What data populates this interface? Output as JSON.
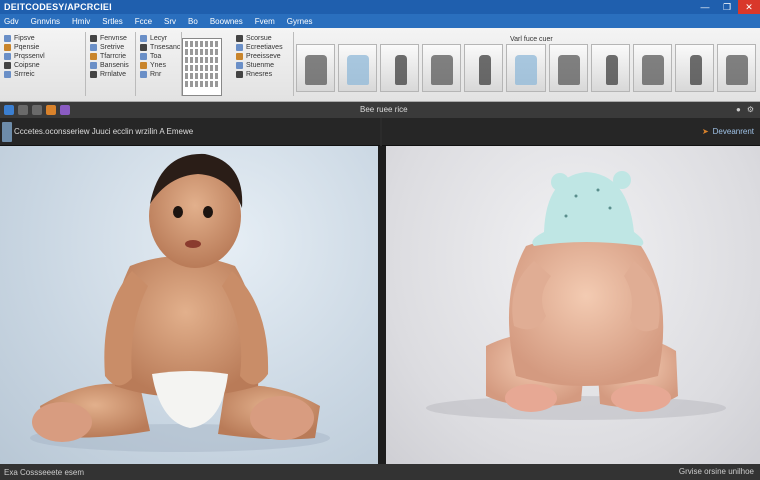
{
  "window": {
    "title": "DEITCODESY/APCRCIEI",
    "controls": {
      "minimize": "—",
      "maximize": "❐",
      "close": "✕"
    }
  },
  "menu": [
    "Gdv",
    "Gnnvins",
    "Hmiv",
    "Srtles",
    "Fcce",
    "Srv",
    "Bo",
    "Boownes",
    "Fvem",
    "Gyrnes"
  ],
  "ribbon": {
    "groups": [
      {
        "rows": [
          "Fipsve",
          "Pqensie",
          "Prqssenvl",
          "Coipsne",
          "Srrreic"
        ]
      },
      {
        "rows": [
          "Fenvnse",
          "Sretrive",
          "Tfarrcrie",
          "Bansenis",
          "Rrnlatve"
        ]
      },
      {
        "rows": [
          "Lecyr",
          "Tnsesanc",
          "Toa",
          "Ynes",
          "Rnr"
        ]
      },
      {
        "rows": [
          "Scorsue",
          "Ecreetiaves",
          "Preeisseve",
          "Stuenme",
          "Rnesres"
        ]
      }
    ],
    "styles_label": "Varl fuce cuer",
    "style_count": 11
  },
  "toolbar": {
    "filename": "Bee ruee rice",
    "right": [
      "●",
      "⚙"
    ]
  },
  "panels": {
    "left_header": "Cccetes.oconsseriew Juuci ecclin wrzilin  A  Emewe",
    "right_header": "Deveanrent"
  },
  "statusbar": {
    "left": "Exa Cossseeete esem",
    "right": "Grvise orsine unilhoe"
  },
  "colors": {
    "titlebar": "#1f5fae",
    "menubar": "#2a6fbe",
    "accent": "#d9822b",
    "hat": "#bfe6e4"
  }
}
